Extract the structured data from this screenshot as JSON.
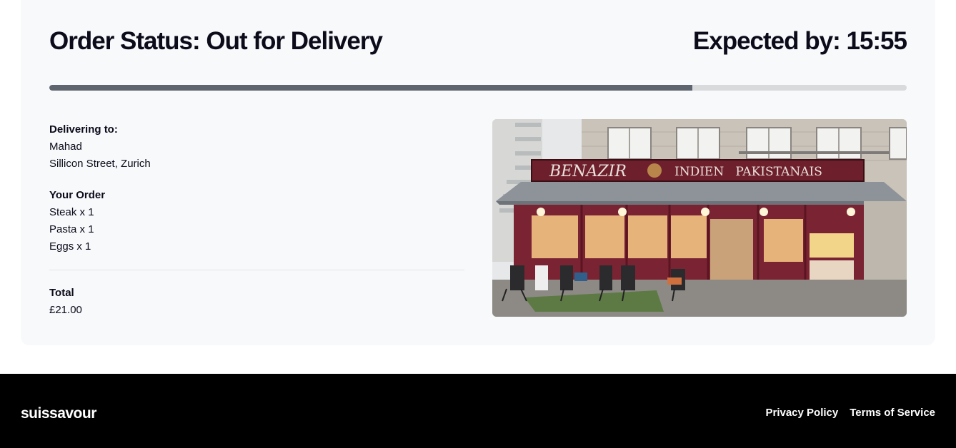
{
  "order": {
    "status_title": "Order Status: Out for Delivery",
    "expected": "Expected by: 15:55",
    "progress": 0.75
  },
  "delivery": {
    "label": "Delivering to:",
    "name": "Mahad",
    "address": "Sillicon Street, Zurich"
  },
  "items": {
    "label": "Your Order",
    "list": [
      "Steak x 1",
      "Pasta x 1",
      "Eggs x 1"
    ]
  },
  "total": {
    "label": "Total",
    "value": "£21.00"
  },
  "restaurant_photo": {
    "sign_name": "BENAZIR",
    "sign_tagline": "INDIEN   PAKISTANAIS"
  },
  "footer": {
    "brand": "suissavour",
    "privacy": "Privacy Policy",
    "terms": "Terms of Service"
  },
  "colors": {
    "progress_fill": "#5f656f",
    "progress_track": "#d9dadc",
    "card_bg": "#f8f9fb",
    "footer_bg": "#000000"
  }
}
